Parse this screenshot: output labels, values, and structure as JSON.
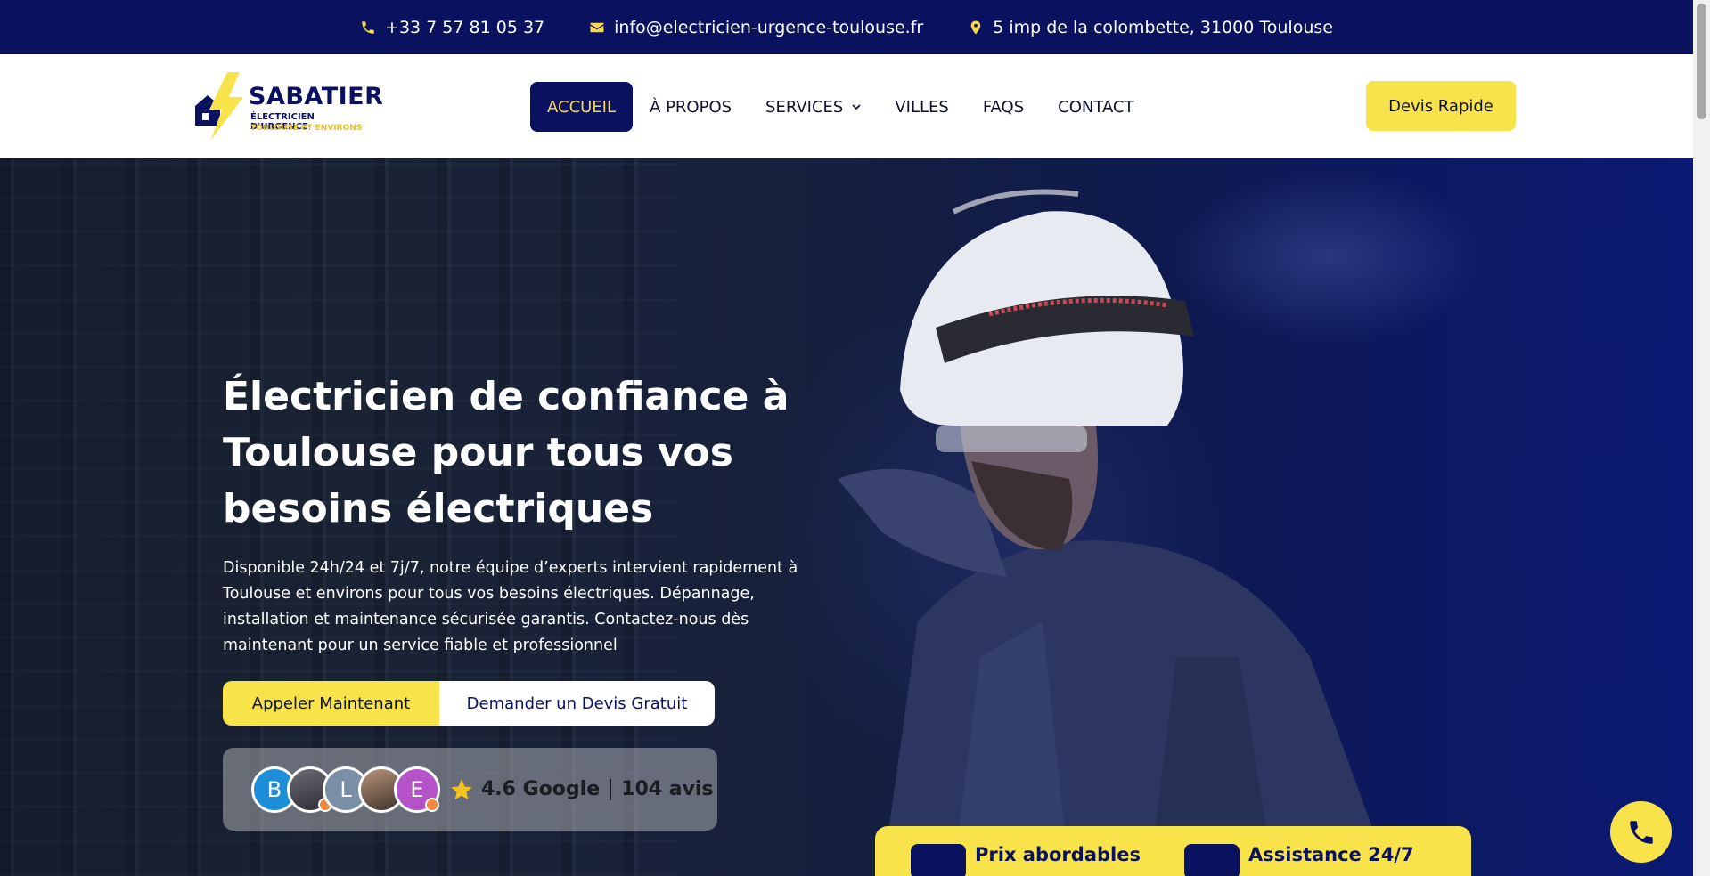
{
  "topbar": {
    "phone": "+33 7 57 81 05 37",
    "email": "info@electricien-urgence-toulouse.fr",
    "address": "5 imp de la colombette, 31000 Toulouse"
  },
  "logo": {
    "brand": "SABATIER",
    "tagline": "ÉLECTRICIEN D'URGENCE",
    "region": "TOULOUSE ET ENVIRONS"
  },
  "nav": {
    "items": [
      {
        "label": "ACCUEIL",
        "active": true
      },
      {
        "label": "À PROPOS"
      },
      {
        "label": "SERVICES"
      },
      {
        "label": "VILLES"
      },
      {
        "label": "FAQS"
      },
      {
        "label": "CONTACT"
      }
    ],
    "cta": "Devis Rapide"
  },
  "hero": {
    "title": "Électricien de confiance à Toulouse pour tous vos besoins électriques",
    "text": "Disponible 24h/24 et 7j/7, notre équipe d’experts intervient rapidement à Toulouse et environs pour tous vos besoins électriques. Dépannage, installation et maintenance sécurisée garantis. Contactez-nous dès maintenant pour un service fiable et professionnel",
    "call_button": "Appeler Maintenant",
    "quote_button": "Demander un Devis Gratuit"
  },
  "reviews": {
    "avatars": [
      "B",
      "",
      "L",
      "",
      "E"
    ],
    "rating": "4.6 Google",
    "count": "104 avis"
  },
  "features": [
    {
      "label": "Prix abordables"
    },
    {
      "label": "Assistance 24/7"
    }
  ],
  "colors": {
    "navy": "#0a1260",
    "yellow": "#f8e44a"
  }
}
